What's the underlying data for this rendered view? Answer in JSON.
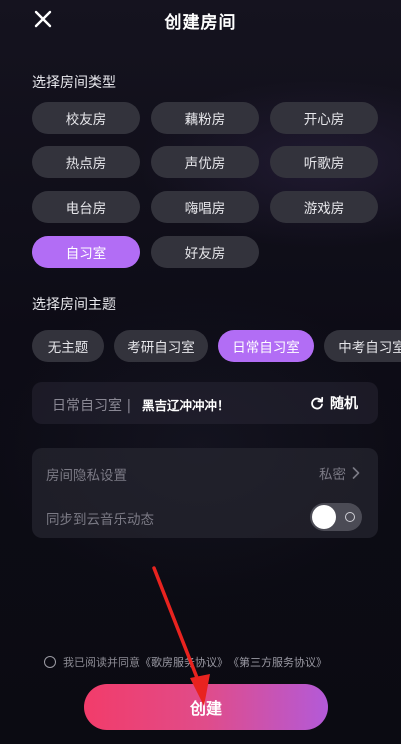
{
  "header": {
    "title": "创建房间"
  },
  "room_type": {
    "label": "选择房间类型",
    "options": [
      "校友房",
      "藕粉房",
      "开心房",
      "热点房",
      "声优房",
      "听歌房",
      "电台房",
      "嗨唱房",
      "游戏房",
      "自习室",
      "好友房"
    ],
    "selected": "自习室"
  },
  "room_theme": {
    "label": "选择房间主题",
    "options": [
      "无主题",
      "考研自习室",
      "日常自习室",
      "中考自习室"
    ],
    "selected": "日常自习室"
  },
  "room_name": {
    "prefix": "日常自习室 |",
    "value": "黑吉辽冲冲冲！",
    "random_label": "随机"
  },
  "settings": {
    "privacy_label": "房间隐私设置",
    "privacy_value": "私密",
    "sync_label": "同步到云音乐动态",
    "sync_on": false
  },
  "agreement": {
    "text": "我已阅读并同意",
    "link1": "《歌房服务协议》",
    "link2": "《第三方服务协议》"
  },
  "create_button": {
    "label": "创建"
  },
  "colors": {
    "accent": "#b26df5",
    "chip_bg": "#33333c",
    "button_start": "#f23c6a",
    "button_end": "#b35ad8",
    "arrow": "#e8231f"
  }
}
